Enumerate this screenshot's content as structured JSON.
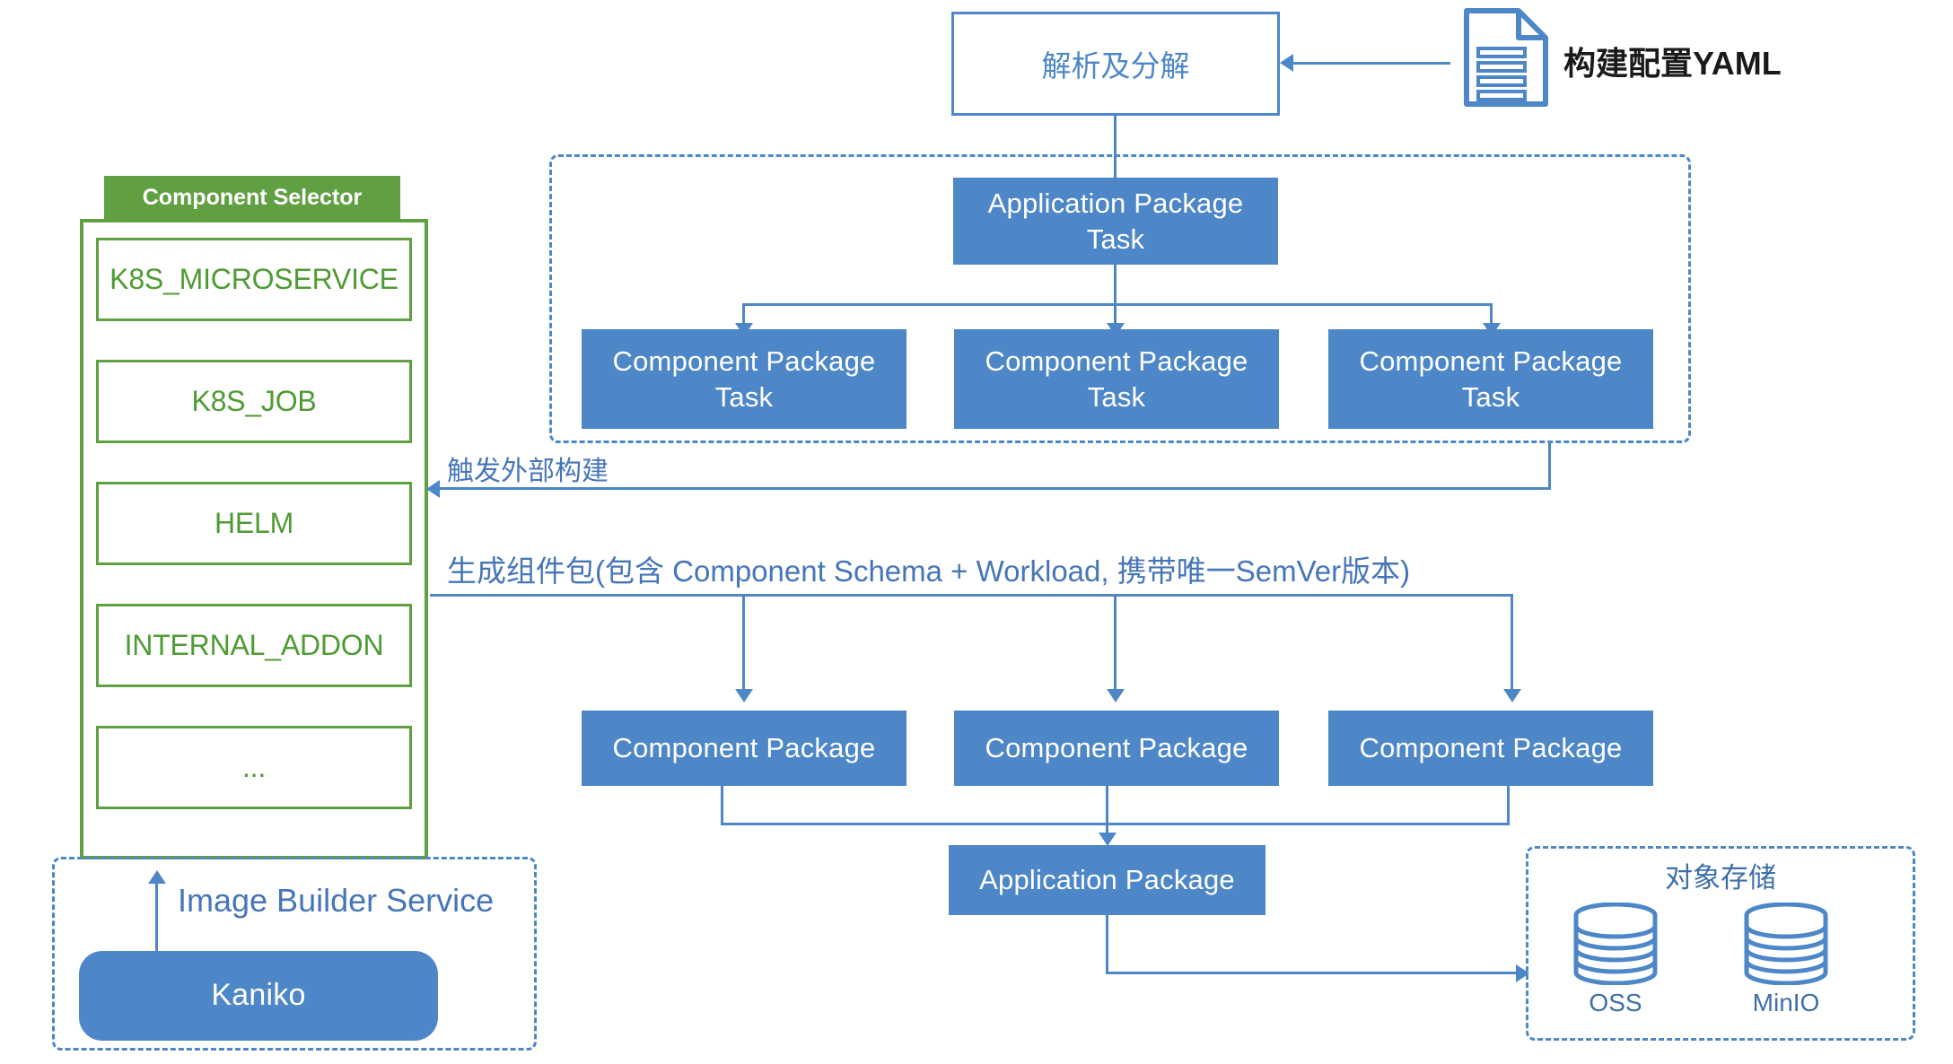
{
  "diagram": {
    "title_nodes": {
      "parse_box": "解析及分解",
      "yaml_label": "构建配置YAML"
    },
    "component_selector": {
      "header": "Component Selector",
      "items": [
        {
          "label": "K8S_MICROSERVICE"
        },
        {
          "label": "K8S_JOB"
        },
        {
          "label": "HELM"
        },
        {
          "label": "INTERNAL_ADDON"
        },
        {
          "label": "..."
        }
      ]
    },
    "image_builder": {
      "title": "Image Builder Service",
      "node": "Kaniko"
    },
    "task_group": {
      "app_task": "Application Package\nTask",
      "app_task_line1": "Application Package",
      "app_task_line2": "Task",
      "component_tasks": [
        {
          "line1": "Component Package",
          "line2": "Task"
        },
        {
          "line1": "Component Package",
          "line2": "Task"
        },
        {
          "line1": "Component Package",
          "line2": "Task"
        }
      ]
    },
    "packages": {
      "component_packages": [
        {
          "label": "Component Package"
        },
        {
          "label": "Component Package"
        },
        {
          "label": "Component Package"
        }
      ],
      "application_package": "Application Package"
    },
    "edge_labels": {
      "trigger_external_build": "触发外部构建",
      "generate_component_package": "生成组件包(包含 Component Schema + Workload, 携带唯一SemVer版本)"
    },
    "object_storage": {
      "title": "对象存储",
      "stores": [
        {
          "label": "OSS"
        },
        {
          "label": "MinIO"
        }
      ]
    },
    "colors": {
      "blue_fill": "#4E87C7",
      "blue_stroke": "#4E87C7",
      "green": "#61A042",
      "green_text": "#4E9B33",
      "blue_text": "#4676B8",
      "storage_text": "#3E6FA8"
    },
    "icons": {
      "yaml_document": "document-icon",
      "database": "database-cylinder-icon"
    }
  }
}
